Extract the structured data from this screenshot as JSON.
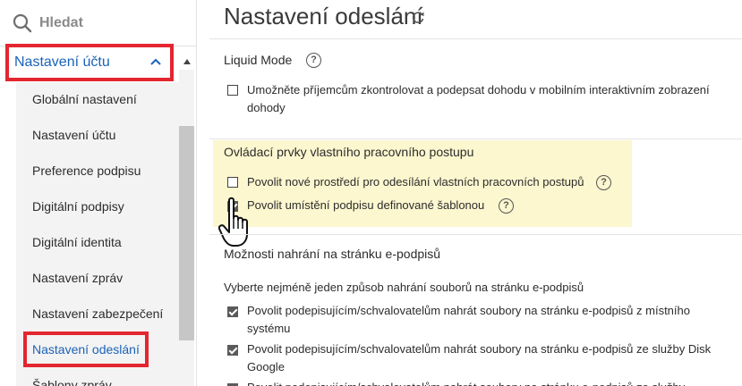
{
  "sidebar": {
    "search_placeholder": "Hledat",
    "section_header": "Nastavení účtu",
    "items": [
      {
        "label": "Globální nastavení"
      },
      {
        "label": "Nastavení účtu"
      },
      {
        "label": "Preference podpisu"
      },
      {
        "label": "Digitální podpisy"
      },
      {
        "label": "Digitální identita"
      },
      {
        "label": "Nastavení zpráv"
      },
      {
        "label": "Nastavení zabezpečení"
      },
      {
        "label": "Nastavení odeslání",
        "active": true
      },
      {
        "label": "Šablony zpráv"
      }
    ]
  },
  "main": {
    "title": "Nastavení odeslání",
    "liquid_mode": {
      "title": "Liquid Mode",
      "option_line1": "Umožněte příjemcům zkontrolovat a podepsat dohodu v mobilním interaktivním zobrazení",
      "option_line2": "dohody",
      "checked": false
    },
    "workflow": {
      "title": "Ovládací prvky vlastního pracovního postupu",
      "option1": "Povolit nové prostředí pro odesílání vlastních pracovních postupů",
      "option1_checked": false,
      "option2": "Povolit umístění podpisu definované šablonou",
      "option2_checked": true
    },
    "upload": {
      "title": "Možnosti nahrání na stránku e-podpisů",
      "description": "Vyberte nejméně jeden způsob nahrání souborů na stránku e-podpisů",
      "option1_line1": "Povolit podepisujícím/schvalovatelům nahrát soubory na stránku e-podpisů z místního",
      "option1_line2": "systému",
      "option1_checked": true,
      "option2_line1": "Povolit podepisujícím/schvalovatelům nahrát soubory na stránku e-podpisů ze služby Disk",
      "option2_line2": "Google",
      "option2_checked": true,
      "option3_line1": "Povolit podepisujícím/schvalovatelům nahrát soubory na stránku e-podpisů ze služby",
      "option3_checked": true
    }
  },
  "colors": {
    "accent": "#1a62b6",
    "callout": "#e3262f",
    "highlight": "#fcf7cf"
  }
}
